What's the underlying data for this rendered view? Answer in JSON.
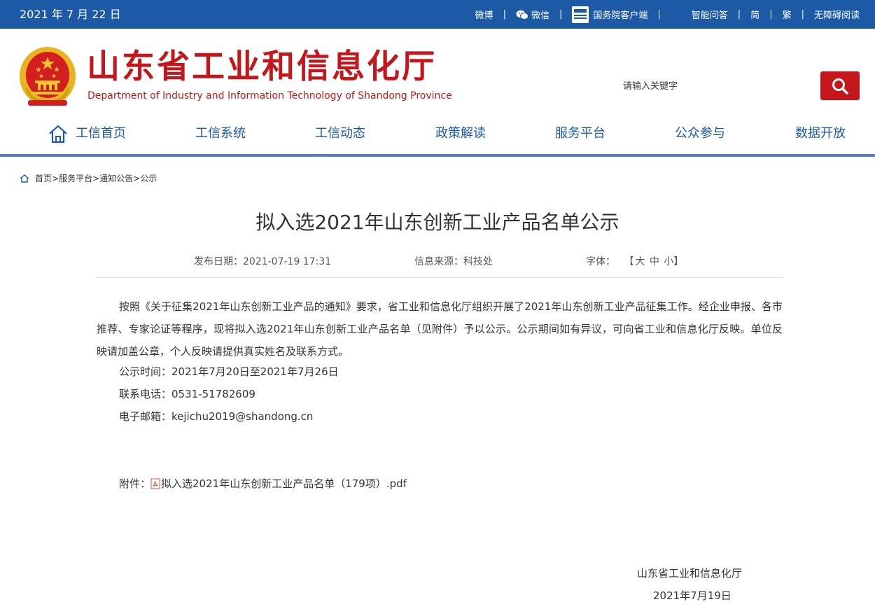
{
  "topbar": {
    "date": "2021 年 7 月 22 日",
    "weibo": "微博",
    "wechat": "微信",
    "gov_client": "国务院客户端",
    "smart_qa": "智能问答",
    "simplified": "简",
    "traditional": "繁",
    "accessible": "无障碍阅读",
    "separator": "|"
  },
  "header": {
    "title": "山东省工业和信息化厅",
    "subtitle": "Department of Industry and Information Technology of Shandong Province",
    "search_placeholder": "请输入关键字"
  },
  "nav": {
    "items": [
      "工信首页",
      "工信系统",
      "工信动态",
      "政策解读",
      "服务平台",
      "公众参与",
      "数据开放"
    ]
  },
  "breadcrumb": {
    "items": [
      "首页",
      "服务平台",
      "通知公告",
      "公示"
    ],
    "separator": ">"
  },
  "article": {
    "title": "拟入选2021年山东创新工业产品名单公示",
    "publish_date_label": "发布日期：",
    "publish_date": "2021-07-19 17:31",
    "source_label": "信息来源：",
    "source": "科技处",
    "font_label": "字体：",
    "font_open": "【",
    "font_large": "大",
    "font_medium": "中",
    "font_small": "小",
    "font_close": "】",
    "body": "按照《关于征集2021年山东创新工业产品的通知》要求，省工业和信息化厅组织开展了2021年山东创新工业产品征集工作。经企业申报、各市推荐、专家论证等程序，现将拟入选2021年山东创新工业产品名单（见附件）予以公示。公示期间如有异议，可向省工业和信息化厅反映。单位反映请加盖公章，个人反映请提供真实姓名及联系方式。",
    "period": "公示时间：2021年7月20日至2021年7月26日",
    "phone": "联系电话：0531-51782609",
    "email": "电子邮箱：kejichu2019@shandong.cn",
    "attachment_label": "附件：",
    "attachment_name": "拟入选2021年山东创新工业产品名单（179项）.pdf",
    "signature_org": "山东省工业和信息化厅",
    "signature_date": "2021年7月19日"
  },
  "colors": {
    "topbar_bg": "#1d5aa6",
    "brand_red": "#c4171b",
    "nav_blue": "#1d5aa6"
  }
}
